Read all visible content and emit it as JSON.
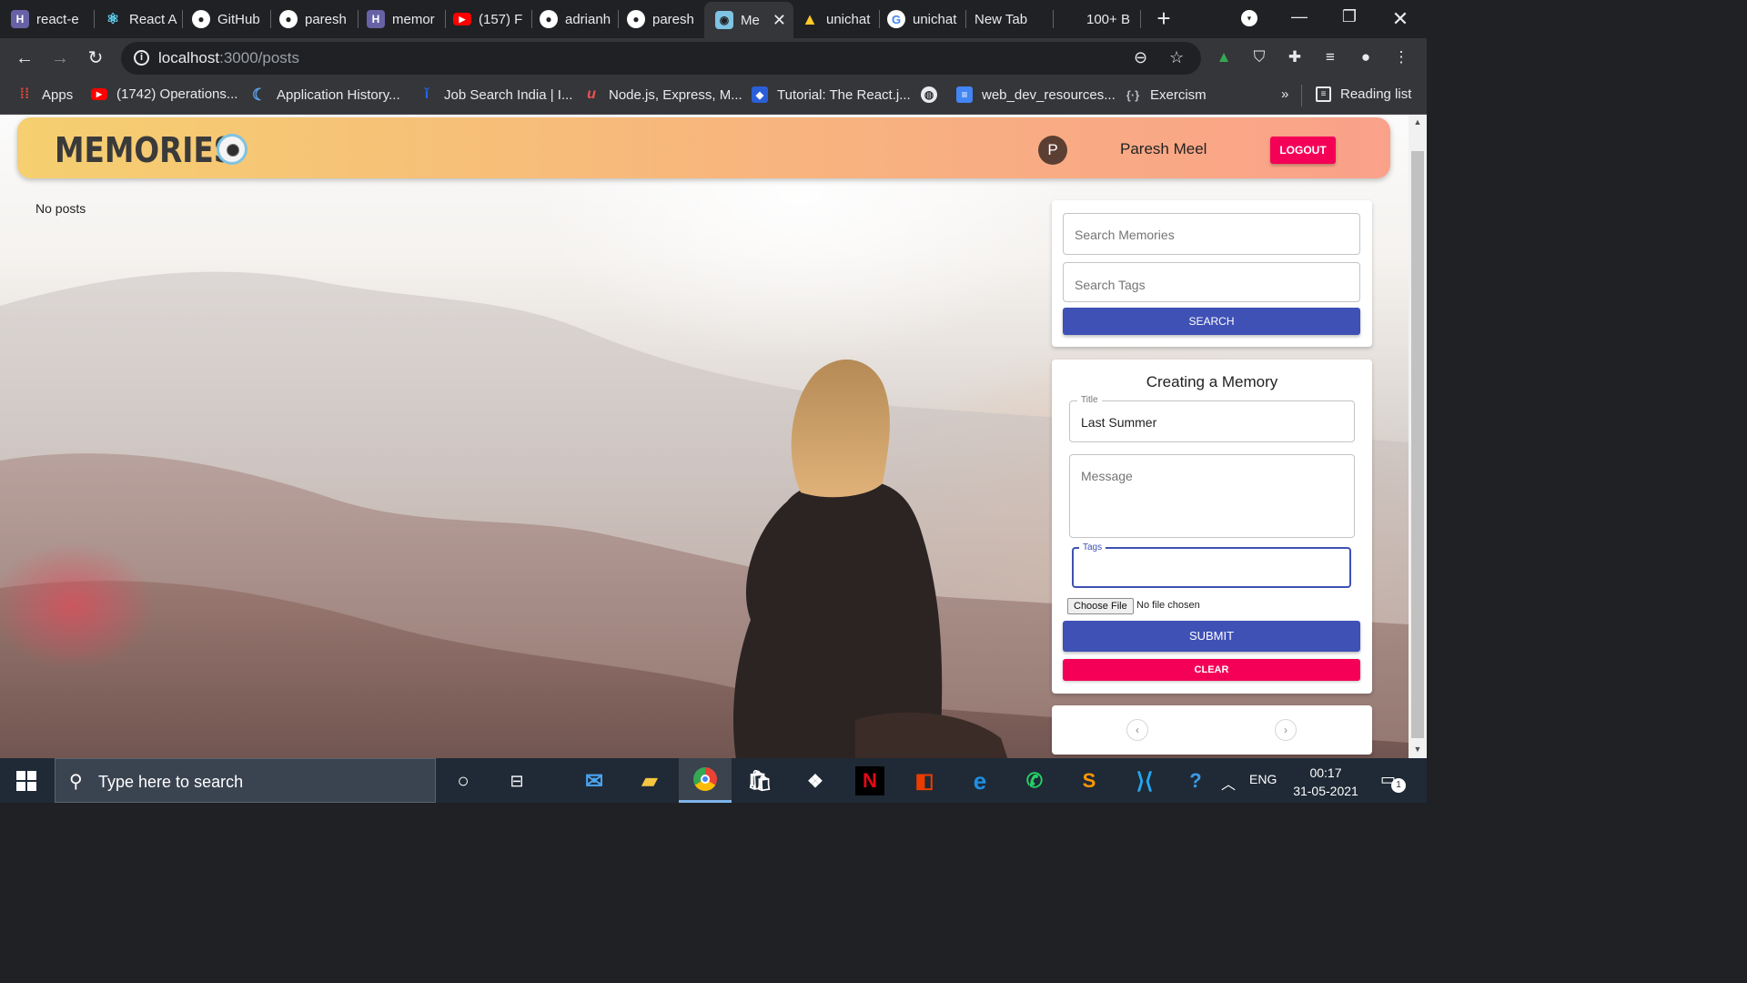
{
  "browser": {
    "tabs": [
      {
        "label": "react-e",
        "icon": "heroku-icon",
        "color": "#6762a6"
      },
      {
        "label": "React A",
        "icon": "react-icon",
        "color": "#61dafb"
      },
      {
        "label": "GitHub",
        "icon": "github-icon",
        "color": "#ffffff"
      },
      {
        "label": "paresh",
        "icon": "github-icon",
        "color": "#ffffff"
      },
      {
        "label": "memor",
        "icon": "heroku-icon",
        "color": "#6762a6"
      },
      {
        "label": "(157) F",
        "icon": "youtube-icon",
        "color": "#ff0000"
      },
      {
        "label": "adrianh",
        "icon": "github-icon",
        "color": "#ffffff"
      },
      {
        "label": "paresh",
        "icon": "github-icon",
        "color": "#ffffff"
      },
      {
        "label": "Me",
        "icon": "memories-icon",
        "color": "#7fc3e3",
        "active": true
      },
      {
        "label": "unichat",
        "icon": "firebase-icon",
        "color": "#ffca28"
      },
      {
        "label": "unichat",
        "icon": "google-icon",
        "color": "#ffffff"
      },
      {
        "label": "New Tab",
        "icon": "",
        "color": ""
      },
      {
        "label": "100+ B",
        "icon": "",
        "color": ""
      }
    ],
    "url_host": "localhost",
    "url_path": ":3000/posts",
    "bookmarks": [
      {
        "label": "Apps",
        "icon": "apps-grid-icon"
      },
      {
        "label": "(1742) Operations...",
        "icon": "youtube-icon"
      },
      {
        "label": "Application History...",
        "icon": "bookmark-c-icon"
      },
      {
        "label": "Job Search India | I...",
        "icon": "indeed-icon"
      },
      {
        "label": "Node.js, Express, M...",
        "icon": "udemy-icon"
      },
      {
        "label": "Tutorial: The React.j...",
        "icon": "react-doc-icon"
      },
      {
        "label": "",
        "icon": "globe-icon"
      },
      {
        "label": "web_dev_resources...",
        "icon": "docs-icon"
      },
      {
        "label": "Exercism",
        "icon": "exercism-icon"
      }
    ],
    "bookmarks_overflow": "»",
    "reading_list": "Reading list"
  },
  "app": {
    "brand": "MEMORIES",
    "user_initial": "P",
    "user_name": "Paresh Meel",
    "logout_label": "LOGOUT",
    "no_posts": "No posts",
    "search": {
      "memories_placeholder": "Search Memories",
      "tags_placeholder": "Search Tags",
      "button": "SEARCH"
    },
    "form": {
      "heading": "Creating a Memory",
      "title_label": "Title",
      "title_value": "Last Summer",
      "message_placeholder": "Message",
      "tags_label": "Tags",
      "tags_value": "",
      "choose_file": "Choose File",
      "file_status": "No file chosen",
      "submit": "SUBMIT",
      "clear": "CLEAR"
    },
    "pagination": {
      "prev": "‹",
      "next": "›"
    },
    "colors": {
      "primary": "#3f51b5",
      "secondary": "#f50057"
    }
  },
  "taskbar": {
    "search_placeholder": "Type here to search",
    "language": "ENG",
    "time": "00:17",
    "date": "31-05-2021",
    "notification_count": "1"
  }
}
